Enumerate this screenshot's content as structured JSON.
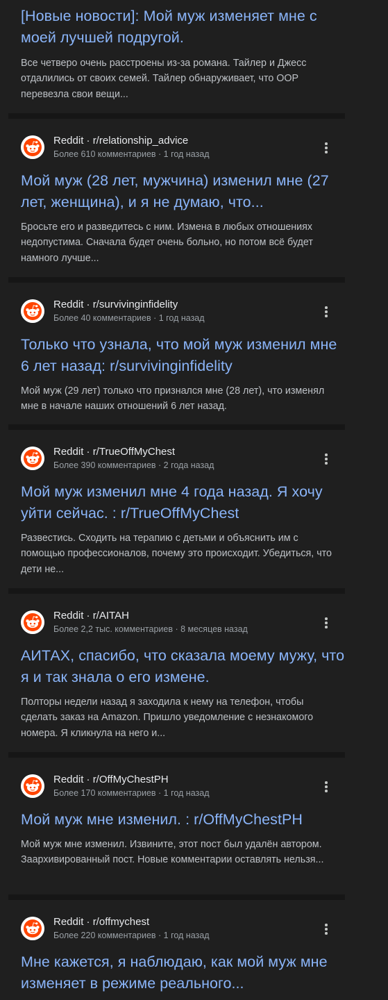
{
  "results": [
    {
      "title": "[Новые новости]: Мой муж изменяет мне с моей лучшей подругой.",
      "snippet": "Все четверо очень расстроены из-за романа. Тайлер и Джесс отдалились от своих семей. Тайлер обнаруживает, что OOP перевезла свои вещи..."
    },
    {
      "source": "Reddit · r/relationship_advice",
      "meta": "Более 610 комментариев · 1 год назад",
      "title": "Мой муж (28 лет, мужчина) изменил мне (27 лет, женщина), и я не думаю, что...",
      "snippet": "Бросьте его и разведитесь с ним. Измена в любых отношениях недопустима. Сначала будет очень больно, но потом всё будет намного лучше..."
    },
    {
      "source": "Reddit · r/survivinginfidelity",
      "meta": "Более 40 комментариев · 1 год назад",
      "title": "Только что узнала, что мой муж изменил мне 6 лет назад: r/survivinginfidelity",
      "snippet": "Мой муж (29 лет) только что признался мне (28 лет), что изменял мне в начале наших отношений 6 лет назад."
    },
    {
      "source": "Reddit · r/TrueOffMyChest",
      "meta": "Более 390 комментариев · 2 года назад",
      "title": "Мой муж изменил мне 4 года назад. Я хочу уйти сейчас. : r/TrueOffMyChest",
      "snippet": "Развестись. Сходить на терапию с детьми и объяснить им с помощью профессионалов, почему это происходит. Убедиться, что дети не..."
    },
    {
      "source": "Reddit · r/AITAH",
      "meta": "Более 2,2 тыс. комментариев · 8 месяцев назад",
      "title": "АИТАХ, спасибо, что сказала моему мужу, что я и так знала о его измене.",
      "snippet": "Полторы недели назад я заходила к нему на телефон, чтобы сделать заказ на Amazon. Пришло уведомление с незнакомого номера. Я кликнула на него и..."
    },
    {
      "source": "Reddit · r/OffMyChestPH",
      "meta": "Более 170 комментариев · 1 год назад",
      "title": "Мой муж мне изменил. : r/OffMyChestPH",
      "snippet": "Мой муж мне изменил. Извините, этот пост был удалён автором. Заархивированный пост. Новые комментарии оставлять нельзя..."
    },
    {
      "source": "Reddit · r/offmychest",
      "meta": "Более 220 комментариев · 1 год назад",
      "title": "Мне кажется, я наблюдаю, как мой муж мне изменяет в режиме реального..."
    }
  ],
  "icons": {
    "site": "reddit-icon",
    "menu": "more-vert-icon"
  },
  "colors": {
    "background": "#1f1f1f",
    "link": "#8ab4f8",
    "text": "#bdc1c6",
    "meta": "#9aa0a6",
    "reddit_orange": "#ff4500"
  }
}
